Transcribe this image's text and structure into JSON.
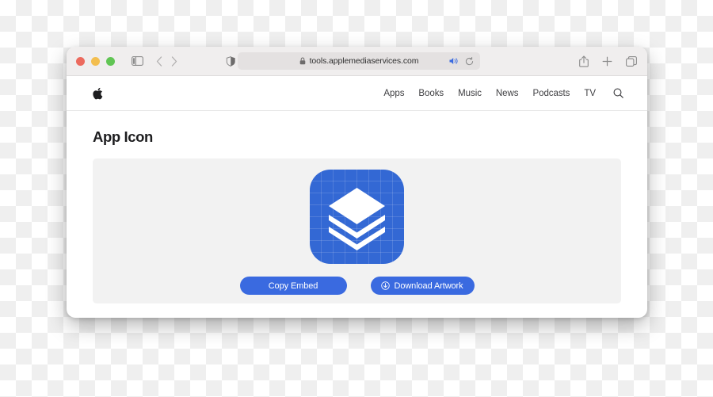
{
  "browser": {
    "traffic_lights": [
      {
        "name": "close",
        "color": "#ec6a5e"
      },
      {
        "name": "minimize",
        "color": "#f3be4f"
      },
      {
        "name": "maximize",
        "color": "#61c554"
      }
    ],
    "sidebar_toggle_icon": "sidebar-icon",
    "back_icon": "chevron-left-icon",
    "forward_icon": "chevron-right-icon",
    "appearance_icon": "contrast-circle-icon",
    "url": "tools.applemediaservices.com",
    "lock_icon": "lock-icon",
    "audio_icon": "speaker-icon",
    "reload_icon": "reload-icon",
    "share_icon": "share-icon",
    "new_tab_icon": "plus-icon",
    "tab_overview_icon": "tab-overview-icon",
    "audio_icon_color": "#3a6ae0"
  },
  "site_nav": {
    "logo": "apple-logo",
    "links": [
      {
        "label": "Apps"
      },
      {
        "label": "Books"
      },
      {
        "label": "Music"
      },
      {
        "label": "News"
      },
      {
        "label": "Podcasts"
      },
      {
        "label": "TV"
      }
    ],
    "search_icon": "search-icon"
  },
  "main": {
    "page_title": "App Icon",
    "artwork": {
      "icon_name": "stacked-layers-app-icon",
      "icon_background_color": "#3368d4",
      "panel_background_color": "#f2f2f2"
    },
    "actions": {
      "copy_embed_label": "Copy Embed",
      "download_label": "Download Artwork",
      "download_icon": "download-circle-icon",
      "button_color": "#3a6ae0"
    }
  }
}
